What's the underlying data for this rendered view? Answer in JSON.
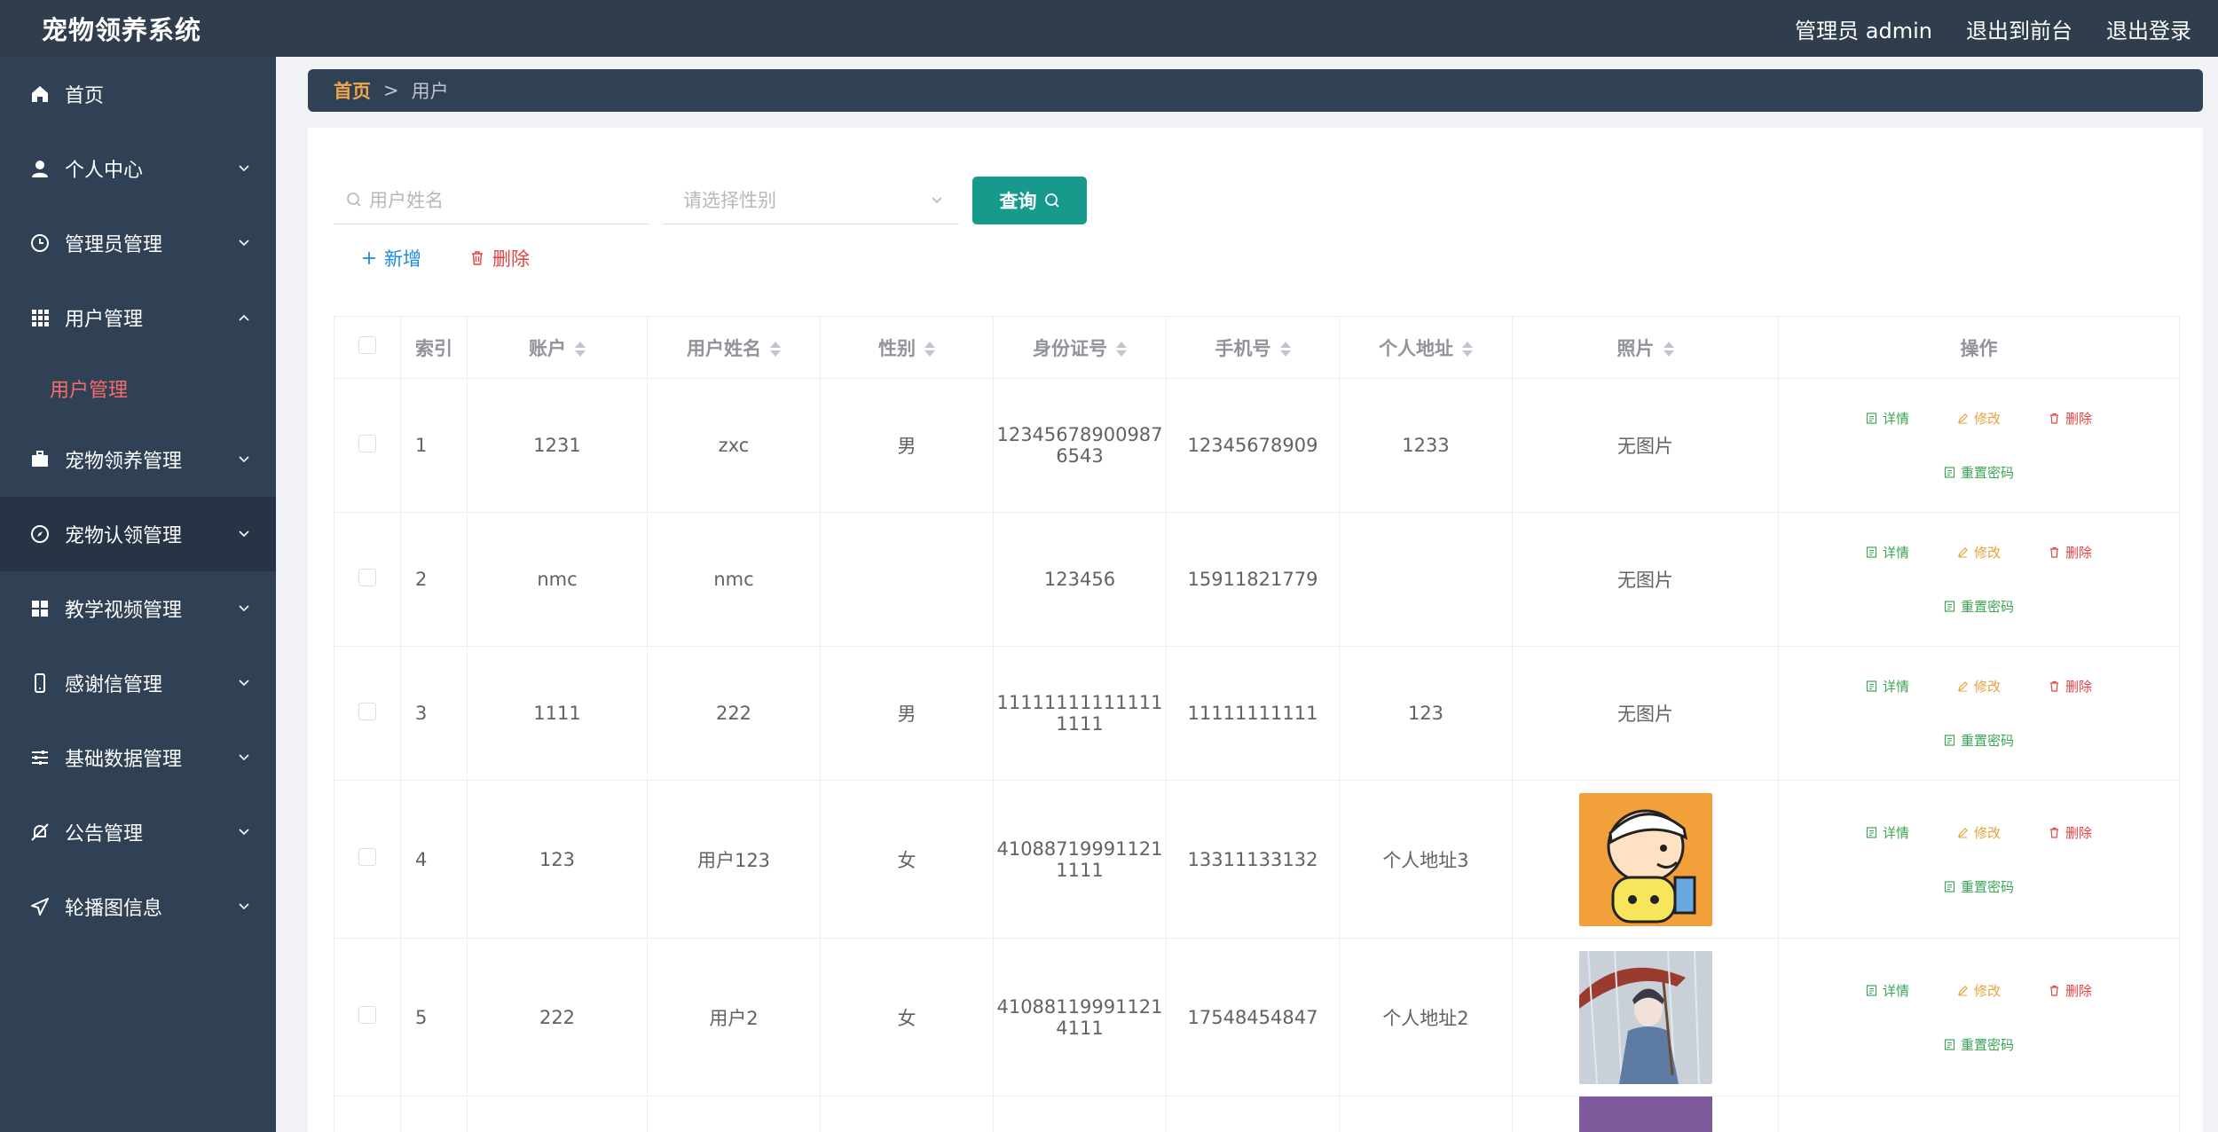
{
  "header": {
    "title": "宠物领养系统",
    "admin_label": "管理员 admin",
    "to_front_label": "退出到前台",
    "logout_label": "退出登录"
  },
  "sidebar": {
    "items": [
      {
        "label": "首页",
        "icon": "home-icon"
      },
      {
        "label": "个人中心",
        "icon": "user-icon"
      },
      {
        "label": "管理员管理",
        "icon": "clock-icon"
      },
      {
        "label": "用户管理",
        "icon": "grid-icon"
      },
      {
        "label": "宠物领养管理",
        "icon": "briefcase-icon"
      },
      {
        "label": "宠物认领管理",
        "icon": "compass-icon"
      },
      {
        "label": "教学视频管理",
        "icon": "squares-icon"
      },
      {
        "label": "感谢信管理",
        "icon": "mobile-icon"
      },
      {
        "label": "基础数据管理",
        "icon": "sliders-icon"
      },
      {
        "label": "公告管理",
        "icon": "bell-off-icon"
      },
      {
        "label": "轮播图信息",
        "icon": "send-icon"
      }
    ],
    "sub_item": "用户管理"
  },
  "breadcrumb": {
    "home": "首页",
    "separator": ">",
    "current": "用户"
  },
  "search": {
    "name_placeholder": "用户姓名",
    "gender_placeholder": "请选择性别",
    "query_label": "查询"
  },
  "actions": {
    "add_label": "新增",
    "delete_label": "删除"
  },
  "table": {
    "headers": {
      "index": "索引",
      "account": "账户",
      "name": "用户姓名",
      "gender": "性别",
      "id_number": "身份证号",
      "phone": "手机号",
      "address": "个人地址",
      "photo": "照片",
      "ops": "操作"
    },
    "no_photo": "无图片",
    "ops": {
      "detail": "详情",
      "edit": "修改",
      "remove": "删除",
      "reset": "重置密码"
    },
    "rows": [
      {
        "index": "1",
        "account": "1231",
        "name": "zxc",
        "gender": "男",
        "id1": "12345678900987",
        "id2": "6543",
        "phone": "12345678909",
        "address": "1233",
        "photo": "无图片"
      },
      {
        "index": "2",
        "account": "nmc",
        "name": "nmc",
        "gender": "",
        "id1": "123456",
        "id2": "",
        "phone": "15911821779",
        "address": "",
        "photo": "无图片"
      },
      {
        "index": "3",
        "account": "1111",
        "name": "222",
        "gender": "男",
        "id1": "11111111111111",
        "id2": "1111",
        "phone": "11111111111",
        "address": "123",
        "photo": "无图片"
      },
      {
        "index": "4",
        "account": "123",
        "name": "用户123",
        "gender": "女",
        "id1": "41088719991121",
        "id2": "1111",
        "phone": "13311133132",
        "address": "个人地址3",
        "photo": "cartoon-boy"
      },
      {
        "index": "5",
        "account": "222",
        "name": "用户2",
        "gender": "女",
        "id1": "41088119991121",
        "id2": "4111",
        "phone": "17548454847",
        "address": "个人地址2",
        "photo": "umbrella-boy"
      }
    ]
  },
  "colors": {
    "topbar": "#2f3d4c",
    "sidebar": "#304156",
    "accent_red": "#f56c6c",
    "query_btn": "#159a8c",
    "breadcrumb_home": "#f2a54a"
  }
}
